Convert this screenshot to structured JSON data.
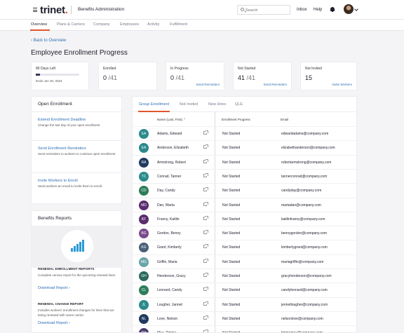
{
  "header": {
    "brand": "trinet",
    "app_name": "Benefits Administration",
    "search_placeholder": "Search",
    "inbox": "Inbox",
    "help": "Help"
  },
  "nav": [
    "Overview",
    "Plans & Carriers",
    "Company",
    "Employees",
    "Activity",
    "Fulfillment"
  ],
  "back_link": "‹ Back to Overview",
  "page_title": "Employee Enrollment Progress",
  "stats": {
    "days": {
      "label": "86 Days Left",
      "progress_pct": 9,
      "ends": "Ends Jun 30, 2024"
    },
    "enrolled": {
      "label": "Enrolled",
      "value": "0",
      "total": "/41"
    },
    "in_progress": {
      "label": "In Progress",
      "value": "0",
      "total": "/41",
      "link": "Send Reminders"
    },
    "not_started": {
      "label": "Not Started",
      "value": "41",
      "total": "/41",
      "link": "Send Reminders"
    },
    "not_invited": {
      "label": "Not Invited",
      "value": "15",
      "link": "Invite Workers"
    }
  },
  "open_enrollment": {
    "title": "Open Enrollment",
    "items": [
      {
        "title": "Extend Enrollment Deadline",
        "desc": "Change the last day of your open enrollment"
      },
      {
        "title": "Send Enrollment Reminders",
        "desc": "Send reminders to workers to continue open enrollment"
      },
      {
        "title": "Invite Workers to Enroll",
        "desc": "Send workers an email to invite them to enroll."
      }
    ]
  },
  "benefits_reports": {
    "title": "Benefits Reports",
    "reports": [
      {
        "title": "RENEWAL ENROLLMENT REPORTS",
        "desc": "Complete census report for the upcoming renewal lines.",
        "link": "Download Report ›"
      },
      {
        "title": "RENEWAL CHANGE REPORT",
        "desc": "Includes workers' enrollment changes for lines that are being renewed with same carrier.",
        "link": "Download Report ›"
      }
    ]
  },
  "table": {
    "tabs": [
      "Group Enrollment",
      "Not Invited",
      "New Hires",
      "QLE"
    ],
    "columns": {
      "name": "Name (Last, First) ⌃",
      "progress": "Enrollment Progress",
      "email": "Email"
    },
    "rows": [
      {
        "initials": "EA",
        "color": "#2b8a8c",
        "name": "Adams, Edward",
        "status": "Not Started",
        "email": "edwardadams@company.com"
      },
      {
        "initials": "EA",
        "color": "#2b8a8c",
        "name": "Anderson, Elizabeth",
        "status": "Not Started",
        "email": "elizabethanderson@company.com"
      },
      {
        "initials": "RA",
        "color": "#1f3a5f",
        "name": "Armstrong, Robert",
        "status": "Not Started",
        "email": "robertarmstrong@company.com"
      },
      {
        "initials": "TC",
        "color": "#2b8a8c",
        "name": "Conrad, Tanner",
        "status": "Not Started",
        "email": "tannerconrad@company.com"
      },
      {
        "initials": "CD",
        "color": "#2e7d5b",
        "name": "Day, Candy",
        "status": "Not Started",
        "email": "candyday@company.com"
      },
      {
        "initials": "MD",
        "color": "#5b2d6e",
        "name": "Dan, Marta",
        "status": "Not Started",
        "email": "martadan@company.com"
      },
      {
        "initials": "KF",
        "color": "#5b2d6e",
        "name": "Franny, Kaitlin",
        "status": "Not Started",
        "email": "kaitlinfranny@company.com"
      },
      {
        "initials": "BG",
        "color": "#7a4a8c",
        "name": "Gordon, Benny",
        "status": "Not Started",
        "email": "bennygordon@company.com"
      },
      {
        "initials": "KG",
        "color": "#4a5f7a",
        "name": "Grant, Kimberly",
        "status": "Not Started",
        "email": "kimberlygrant@company.com"
      },
      {
        "initials": "MG",
        "color": "#6aa3a8",
        "name": "Griffin, Maria",
        "status": "Not Started",
        "email": "mariagriffin@company.com"
      },
      {
        "initials": "GH",
        "color": "#2b6a5a",
        "name": "Henderson, Gracy",
        "status": "Not Started",
        "email": "gracyhenderson@company.com"
      },
      {
        "initials": "CL",
        "color": "#2e7d5b",
        "name": "Leonard, Candy",
        "status": "Not Started",
        "email": "candyleonard@company.com"
      },
      {
        "initials": "JL",
        "color": "#2b8a8c",
        "name": "Lougher, Jannet",
        "status": "Not Started",
        "email": "jennetlougher@company.com"
      },
      {
        "initials": "NL",
        "color": "#1f3a5f",
        "name": "Love, Nelson",
        "status": "Not Started",
        "email": "nelsonlove@company.com"
      },
      {
        "initials": "TM",
        "color": "#4a3a6e",
        "name": "Moe, Timmy",
        "status": "Not Started",
        "email": "timmymoe@company.com"
      }
    ]
  }
}
